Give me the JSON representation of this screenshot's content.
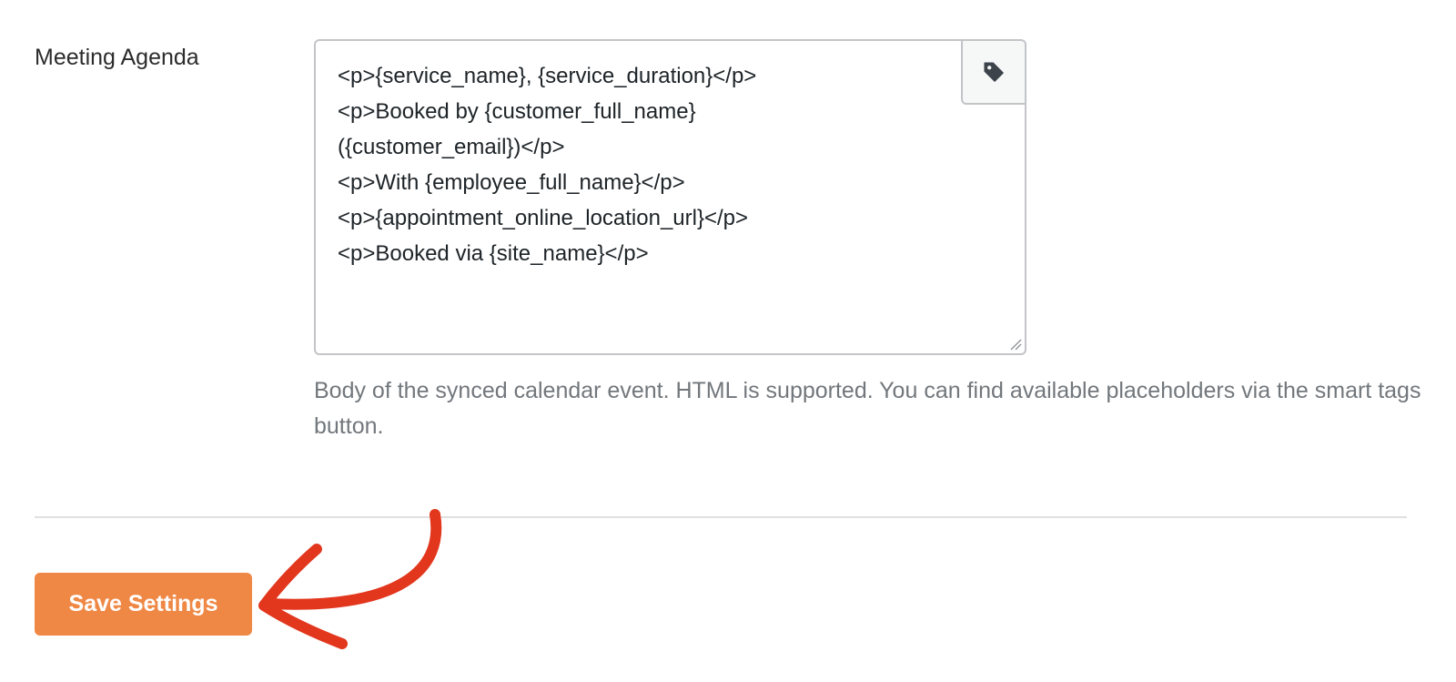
{
  "field": {
    "label": "Meeting Agenda",
    "value": "<p>{service_name}, {service_duration}</p>\n<p>Booked by {customer_full_name}\n({customer_email})</p>\n<p>With {employee_full_name}</p>\n<p>{appointment_online_location_url}</p>\n<p>Booked via {site_name}</p>",
    "smart_tags_icon": "tag-icon",
    "description": "Body of the synced calendar event. HTML is supported. You can find available placeholders via the smart tags button."
  },
  "footer": {
    "save_label": "Save Settings"
  },
  "colors": {
    "accent": "#ef8845",
    "annotation_arrow": "#e2361d",
    "description_text": "#72777c"
  }
}
